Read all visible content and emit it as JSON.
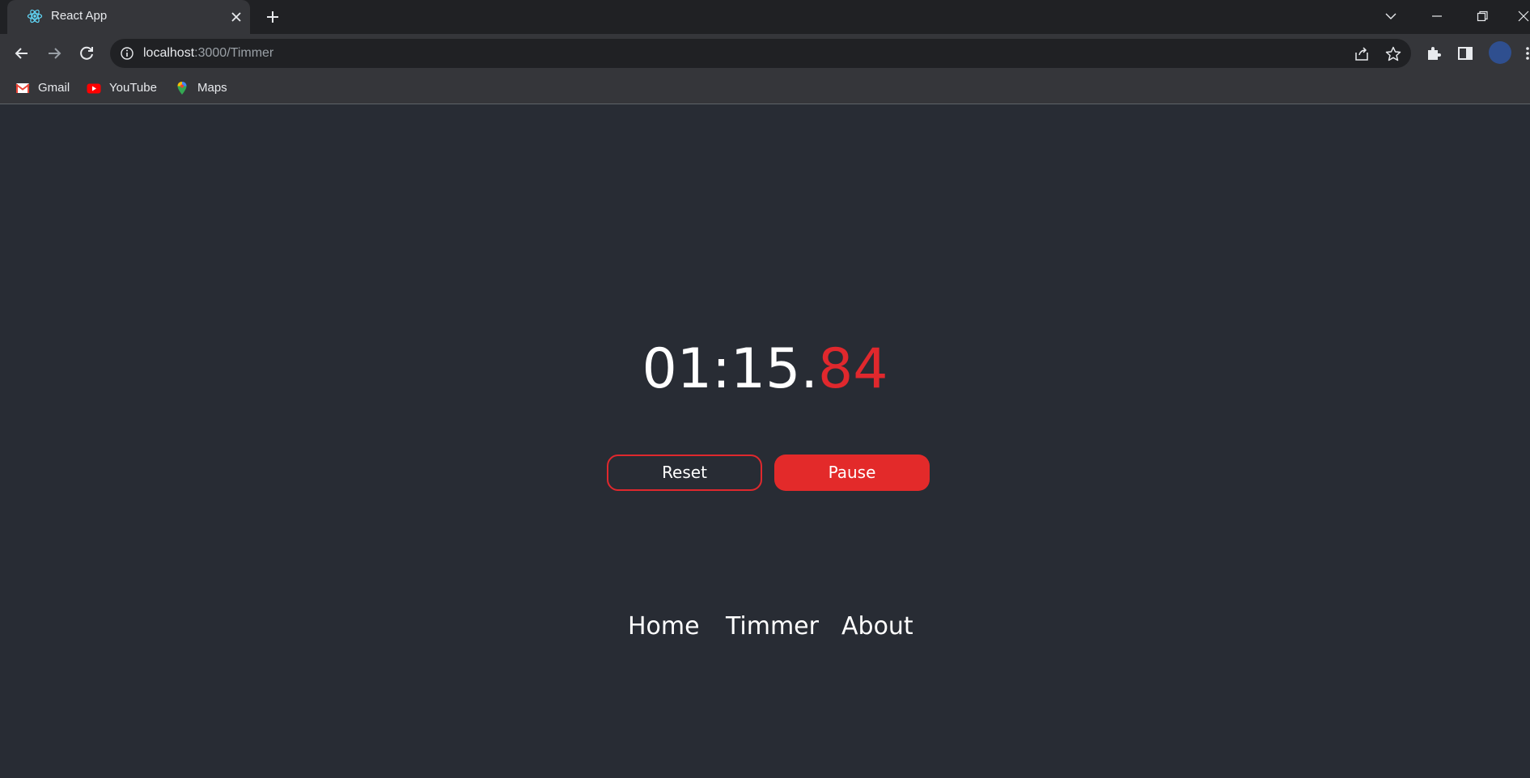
{
  "browser": {
    "tab": {
      "title": "React App",
      "favicon": "react-logo-icon"
    },
    "address": {
      "host": "localhost",
      "path": ":3000/Timmer"
    },
    "bookmarks": [
      {
        "label": "Gmail",
        "icon": "gmail-icon"
      },
      {
        "label": "YouTube",
        "icon": "youtube-icon"
      },
      {
        "label": "Maps",
        "icon": "maps-icon"
      }
    ]
  },
  "timer": {
    "main": "01:15.",
    "ms": "84"
  },
  "controls": {
    "reset_label": "Reset",
    "pause_label": "Pause"
  },
  "nav": {
    "items": [
      {
        "label": "Home"
      },
      {
        "label": "Timmer"
      },
      {
        "label": "About"
      }
    ]
  },
  "colors": {
    "background": "#282c34",
    "accent": "#e32a2a"
  }
}
